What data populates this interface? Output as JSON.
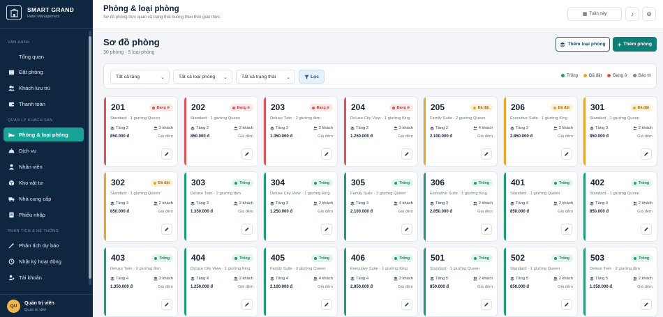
{
  "brand": {
    "name": "SMART GRAND",
    "sub": "Hotel Management"
  },
  "sidebar": {
    "sections": [
      {
        "label": "VẬN HÀNH"
      },
      {
        "label": "QUẢN LÝ KHÁCH SẠN"
      },
      {
        "label": "PHÂN TÍCH & HỆ THỐNG"
      }
    ],
    "items": [
      {
        "label": "Tổng quan",
        "icon": "grid-icon"
      },
      {
        "label": "Đặt phòng",
        "icon": "calendar-icon"
      },
      {
        "label": "Khách lưu trú",
        "icon": "users-icon"
      },
      {
        "label": "Thanh toán",
        "icon": "wallet-icon"
      },
      {
        "label": "Phòng & loại phòng",
        "icon": "bed-icon",
        "active": true
      },
      {
        "label": "Dịch vụ",
        "icon": "bell-icon"
      },
      {
        "label": "Nhân viên",
        "icon": "user-icon"
      },
      {
        "label": "Kho vật tư",
        "icon": "box-icon"
      },
      {
        "label": "Nhà cung cấp",
        "icon": "truck-icon"
      },
      {
        "label": "Phiếu nhập",
        "icon": "receipt-icon"
      },
      {
        "label": "Phân tích dự báo",
        "icon": "chart-icon"
      },
      {
        "label": "Nhật ký hoạt động",
        "icon": "history-icon"
      },
      {
        "label": "Tài khoản",
        "icon": "account-icon"
      }
    ],
    "user": {
      "initials": "QU",
      "name": "Quản trị viên",
      "role": "Quản trị viên"
    }
  },
  "topbar": {
    "title": "Phòng & loại phòng",
    "subtitle": "Sơ đồ phòng trực quan và trạng thái buồng theo thời gian thực",
    "date_label": "Tuần này"
  },
  "board": {
    "title": "Sơ đồ phòng",
    "summary": "30 phòng · 5 loại phòng",
    "btn_types": "Thêm loại phòng",
    "btn_add": "Thêm phòng",
    "filters": {
      "floor": "Tất cả tầng",
      "type": "Tất cả loại phòng",
      "status": "Tất cả trạng thái",
      "apply": "Lọc"
    },
    "legend": [
      {
        "label": "Trống",
        "color": "#1f9d72"
      },
      {
        "label": "Đã đặt",
        "color": "#e6a72e"
      },
      {
        "label": "Đang ở",
        "color": "#d95757"
      },
      {
        "label": "Bảo trì",
        "color": "#7b8594"
      }
    ]
  },
  "status_colors": {
    "occupied": "#d95757",
    "booked": "#e6a72e",
    "vacant": "#1f9d72"
  },
  "price_tag": "Giá đêm",
  "rooms": [
    {
      "no": "201",
      "status": "Đang ở",
      "kind": "occupied",
      "type": "Standard · 1 giường Queen",
      "floor": "Tầng 2",
      "cap": "2 khách",
      "price": "850.000 đ"
    },
    {
      "no": "202",
      "status": "Đang ở",
      "kind": "occupied",
      "type": "Standard · 1 giường Queen",
      "floor": "Tầng 2",
      "cap": "2 khách",
      "price": "850.000 đ"
    },
    {
      "no": "203",
      "status": "Đang ở",
      "kind": "occupied",
      "type": "Deluxe Twin · 2 giường đơn",
      "floor": "Tầng 2",
      "cap": "2 khách",
      "price": "1.350.000 đ"
    },
    {
      "no": "204",
      "status": "Đang ở",
      "kind": "occupied",
      "type": "Deluxe City View · 1 giường King",
      "floor": "Tầng 2",
      "cap": "2 khách",
      "price": "1.250.000 đ"
    },
    {
      "no": "205",
      "status": "Đã đặt",
      "kind": "booked",
      "type": "Family Suite · 2 giường Queen",
      "floor": "Tầng 2",
      "cap": "4 khách",
      "price": "2.100.000 đ"
    },
    {
      "no": "206",
      "status": "Đã đặt",
      "kind": "booked",
      "type": "Executive Suite · 1 giường King",
      "floor": "Tầng 2",
      "cap": "2 khách",
      "price": "2.850.000 đ"
    },
    {
      "no": "301",
      "status": "Đã đặt",
      "kind": "booked",
      "type": "Standard · 1 giường Queen",
      "floor": "Tầng 3",
      "cap": "2 khách",
      "price": "850.000 đ"
    },
    {
      "no": "302",
      "status": "Đã đặt",
      "kind": "booked",
      "type": "Standard · 1 giường Queen",
      "floor": "Tầng 3",
      "cap": "2 khách",
      "price": "850.000 đ"
    },
    {
      "no": "303",
      "status": "Trống",
      "kind": "vacant",
      "type": "Deluxe Twin · 2 giường đơn",
      "floor": "Tầng 3",
      "cap": "2 khách",
      "price": "1.350.000 đ"
    },
    {
      "no": "304",
      "status": "Trống",
      "kind": "vacant",
      "type": "Deluxe City View · 1 giường King",
      "floor": "Tầng 3",
      "cap": "2 khách",
      "price": "1.250.000 đ"
    },
    {
      "no": "305",
      "status": "Trống",
      "kind": "vacant",
      "type": "Family Suite · 2 giường Queen",
      "floor": "Tầng 3",
      "cap": "4 khách",
      "price": "2.100.000 đ"
    },
    {
      "no": "306",
      "status": "Trống",
      "kind": "vacant",
      "type": "Executive Suite · 1 giường King",
      "floor": "Tầng 3",
      "cap": "2 khách",
      "price": "2.850.000 đ"
    },
    {
      "no": "401",
      "status": "Trống",
      "kind": "vacant",
      "type": "Standard · 1 giường Queen",
      "floor": "Tầng 4",
      "cap": "2 khách",
      "price": "850.000 đ"
    },
    {
      "no": "402",
      "status": "Trống",
      "kind": "vacant",
      "type": "Standard · 1 giường Queen",
      "floor": "Tầng 4",
      "cap": "2 khách",
      "price": "850.000 đ"
    },
    {
      "no": "403",
      "status": "Trống",
      "kind": "vacant",
      "type": "Deluxe Twin · 2 giường đơn",
      "floor": "Tầng 4",
      "cap": "2 khách",
      "price": "1.350.000 đ"
    },
    {
      "no": "404",
      "status": "Trống",
      "kind": "vacant",
      "type": "Deluxe City View · 1 giường King",
      "floor": "Tầng 4",
      "cap": "2 khách",
      "price": "1.250.000 đ"
    },
    {
      "no": "405",
      "status": "Trống",
      "kind": "vacant",
      "type": "Family Suite · 2 giường Queen",
      "floor": "Tầng 4",
      "cap": "4 khách",
      "price": "2.100.000 đ"
    },
    {
      "no": "406",
      "status": "Trống",
      "kind": "vacant",
      "type": "Executive Suite · 1 giường King",
      "floor": "Tầng 4",
      "cap": "2 khách",
      "price": "2.850.000 đ"
    },
    {
      "no": "501",
      "status": "Trống",
      "kind": "vacant",
      "type": "Standard · 1 giường Queen",
      "floor": "Tầng 5",
      "cap": "2 khách",
      "price": "850.000 đ"
    },
    {
      "no": "502",
      "status": "Trống",
      "kind": "vacant",
      "type": "Standard · 1 giường Queen",
      "floor": "Tầng 5",
      "cap": "2 khách",
      "price": "850.000 đ"
    },
    {
      "no": "503",
      "status": "Trống",
      "kind": "vacant",
      "type": "Deluxe Twin · 2 giường đơn",
      "floor": "Tầng 5",
      "cap": "2 khách",
      "price": "1.350.000 đ"
    }
  ]
}
